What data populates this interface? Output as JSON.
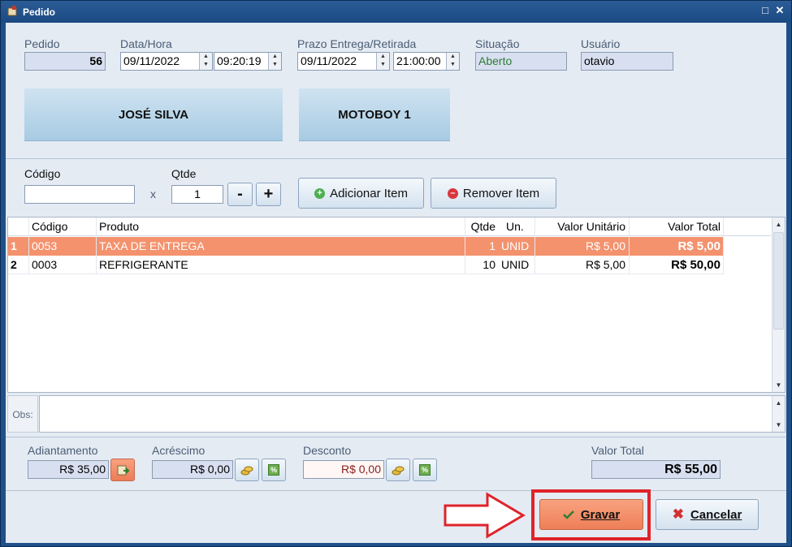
{
  "window": {
    "title": "Pedido"
  },
  "header": {
    "pedido": {
      "label": "Pedido",
      "value": "56"
    },
    "data_hora": {
      "label": "Data/Hora",
      "date": "09/11/2022",
      "time": "09:20:19"
    },
    "prazo": {
      "label": "Prazo Entrega/Retirada",
      "date": "09/11/2022",
      "time": "21:00:00"
    },
    "situacao": {
      "label": "Situação",
      "value": "Aberto"
    },
    "usuario": {
      "label": "Usuário",
      "value": "otavio"
    }
  },
  "customer_button": "JOSÉ SILVA",
  "courier_button": "MOTOBOY 1",
  "item_entry": {
    "codigo_label": "Código",
    "codigo_value": "",
    "times_sign": "x",
    "qtde_label": "Qtde",
    "qtde_value": "1",
    "minus_label": "-",
    "plus_label": "+",
    "add_label": "Adicionar Item",
    "remove_label": "Remover Item"
  },
  "grid": {
    "columns": [
      "Código",
      "Produto",
      "Qtde",
      "Un.",
      "Valor Unitário",
      "Valor Total"
    ],
    "rows": [
      {
        "n": "1",
        "codigo": "0053",
        "produto": "TAXA DE ENTREGA",
        "qtde": "1",
        "un": "UNID",
        "unit": "R$ 5,00",
        "total": "R$ 5,00",
        "selected": true
      },
      {
        "n": "2",
        "codigo": "0003",
        "produto": "REFRIGERANTE",
        "qtde": "10",
        "un": "UNID",
        "unit": "R$ 5,00",
        "total": "R$ 50,00",
        "selected": false
      }
    ],
    "selected_color": "#f4926e"
  },
  "obs": {
    "label": "Obs:",
    "value": ""
  },
  "totals": {
    "adiantamento": {
      "label": "Adiantamento",
      "value": "R$ 35,00"
    },
    "acrescimo": {
      "label": "Acréscimo",
      "value": "R$ 0,00"
    },
    "desconto": {
      "label": "Desconto",
      "value": "R$ 0,00"
    },
    "valor_total": {
      "label": "Valor Total",
      "value": "R$ 55,00"
    }
  },
  "footer": {
    "gravar_label": "Gravar",
    "cancelar_label": "Cancelar",
    "highlight_color": "#e0232a"
  }
}
